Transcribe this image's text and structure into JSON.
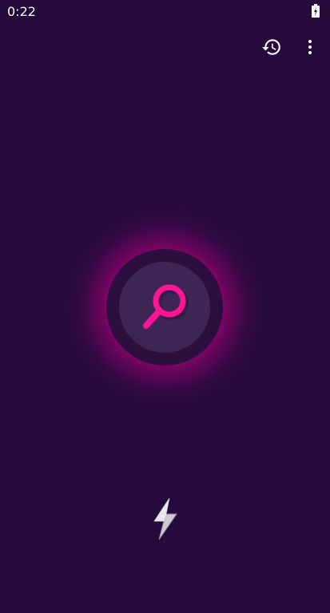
{
  "status_bar": {
    "time": "0:22",
    "battery_icon": "battery-charging-icon"
  },
  "toolbar": {
    "history_icon": "history-icon",
    "more_icon": "more-vert-icon"
  },
  "scan": {
    "icon": "search-icon",
    "accent_color": "#ff1493"
  },
  "flash": {
    "icon": "lightning-bolt-icon"
  },
  "colors": {
    "background": "#260a3b",
    "glow": "#e6009a",
    "button_outer": "#2c0f3e",
    "button_inner": "#3f2556"
  }
}
